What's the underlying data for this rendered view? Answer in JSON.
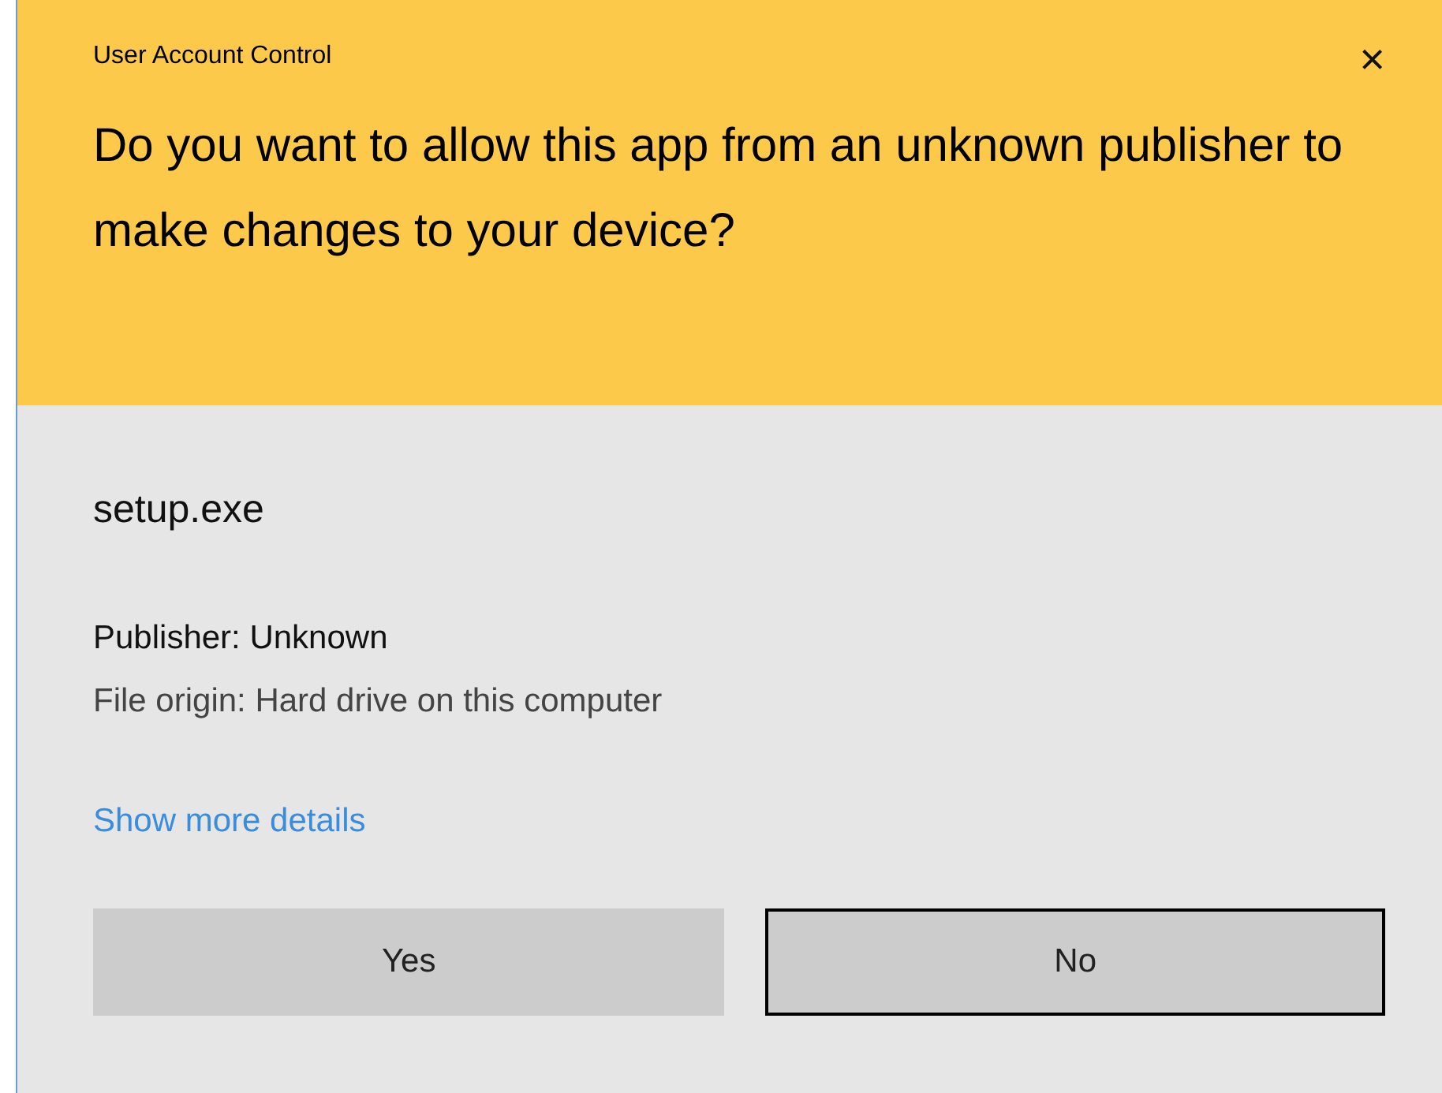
{
  "window": {
    "title": "User Account Control",
    "close": "×"
  },
  "question": "Do you want to allow this app from an unknown publisher to make changes to your device?",
  "program": "setup.exe",
  "details": [
    {
      "text": "Publisher: Unknown",
      "kind": "primary"
    },
    {
      "text": "File origin: Hard drive on this computer",
      "kind": "secondary"
    }
  ],
  "link": "Show more details",
  "buttons": [
    {
      "label": "Yes",
      "focused": false
    },
    {
      "label": "No",
      "focused": true
    }
  ]
}
